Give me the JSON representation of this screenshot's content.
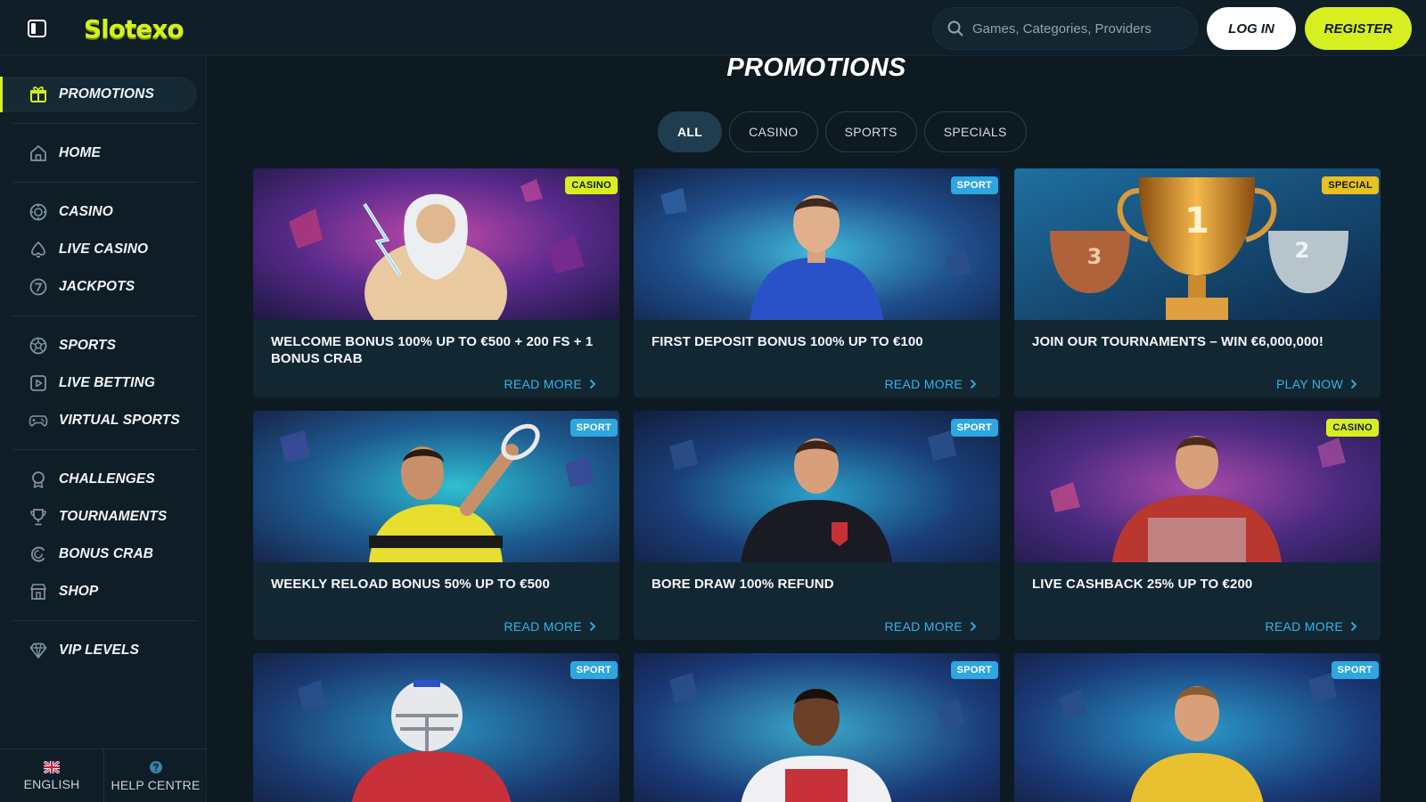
{
  "header": {
    "logo_text": "Slotexo",
    "search_placeholder": "Games, Categories, Providers",
    "login_label": "LOG IN",
    "register_label": "REGISTER",
    "colors": {
      "accent": "#d7ee21",
      "background": "#0d1a22",
      "link": "#35b3e8"
    }
  },
  "sidebar": {
    "items": [
      {
        "label": "PROMOTIONS",
        "icon": "gift-icon",
        "active": true
      },
      {
        "label": "HOME",
        "icon": "home-icon"
      },
      {
        "label": "CASINO",
        "icon": "casino-chip-icon"
      },
      {
        "label": "LIVE CASINO",
        "icon": "live-casino-icon"
      },
      {
        "label": "JACKPOTS",
        "icon": "jackpot-icon"
      },
      {
        "label": "SPORTS",
        "icon": "soccer-ball-icon"
      },
      {
        "label": "LIVE BETTING",
        "icon": "play-icon"
      },
      {
        "label": "VIRTUAL SPORTS",
        "icon": "gamepad-icon"
      },
      {
        "label": "CHALLENGES",
        "icon": "medal-icon"
      },
      {
        "label": "TOURNAMENTS",
        "icon": "trophy-icon"
      },
      {
        "label": "BONUS CRAB",
        "icon": "crab-icon"
      },
      {
        "label": "SHOP",
        "icon": "shop-icon"
      },
      {
        "label": "VIP LEVELS",
        "icon": "diamond-icon"
      }
    ],
    "footer": {
      "language_label": "ENGLISH",
      "help_label": "HELP CENTRE"
    }
  },
  "main": {
    "title": "PROMOTIONS",
    "tabs": [
      {
        "label": "ALL",
        "active": true
      },
      {
        "label": "CASINO"
      },
      {
        "label": "SPORTS"
      },
      {
        "label": "SPECIALS"
      }
    ],
    "cards": [
      {
        "badge": "CASINO",
        "title": "WELCOME BONUS 100% UP TO €500 + 200 FS + 1 BONUS CRAB",
        "link": "READ MORE"
      },
      {
        "badge": "SPORT",
        "title": "FIRST DEPOSIT BONUS 100% UP TO €100",
        "link": "READ MORE"
      },
      {
        "badge": "SPECIAL",
        "title": "JOIN OUR TOURNAMENTS – WIN €6,000,000!",
        "link": "PLAY NOW"
      },
      {
        "badge": "SPORT",
        "title": "WEEKLY RELOAD BONUS 50% UP TO €500",
        "link": "READ MORE"
      },
      {
        "badge": "SPORT",
        "title": "BORE DRAW 100% REFUND",
        "link": "READ MORE"
      },
      {
        "badge": "CASINO",
        "title": "LIVE CASHBACK 25% UP TO €200",
        "link": "READ MORE"
      },
      {
        "badge": "SPORT"
      },
      {
        "badge": "SPORT"
      },
      {
        "badge": "SPORT"
      }
    ]
  }
}
